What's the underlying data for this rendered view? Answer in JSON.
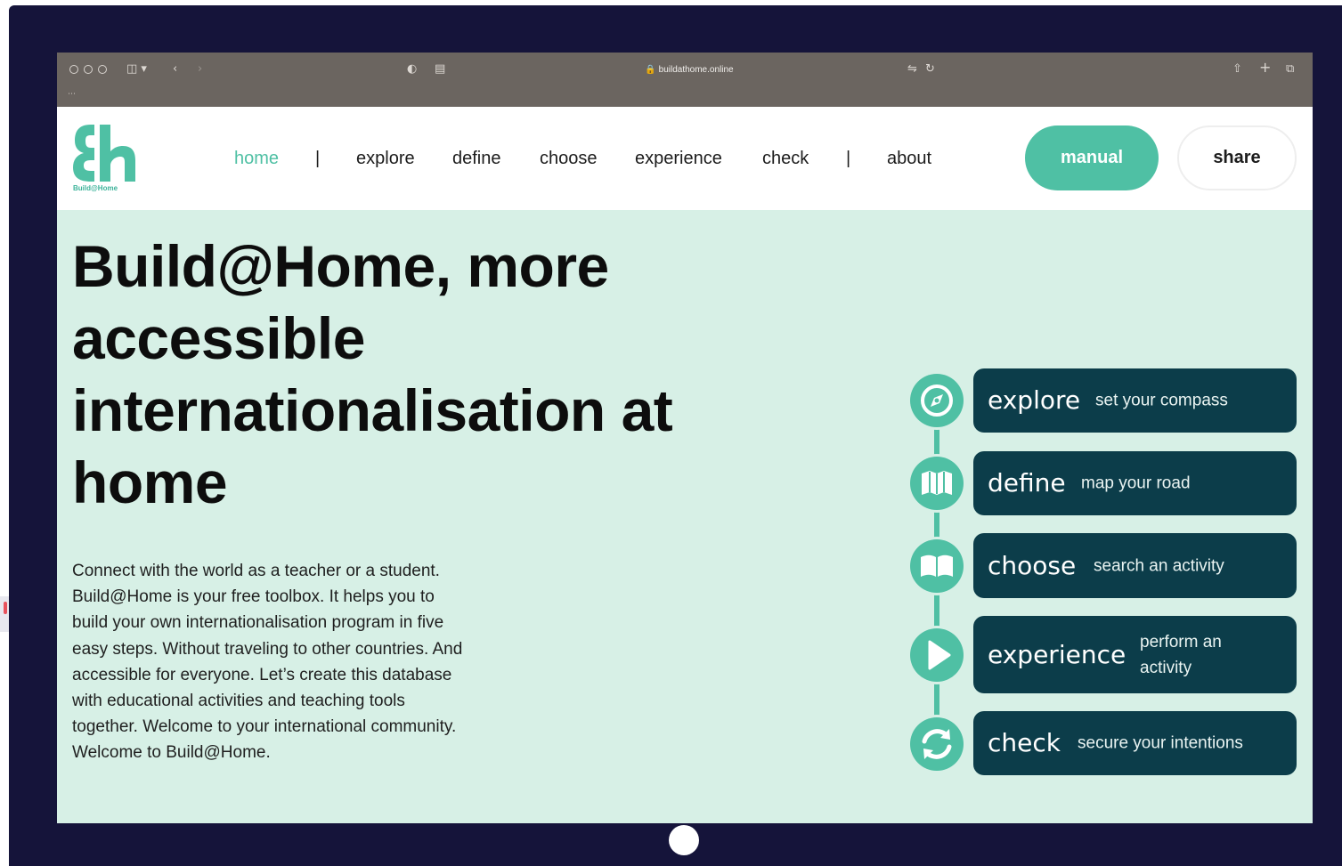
{
  "browser": {
    "url": "buildathome.online"
  },
  "logo": {
    "caption": "Build@Home"
  },
  "nav": {
    "items": [
      "home",
      "explore",
      "define",
      "choose",
      "experience",
      "check",
      "about"
    ],
    "active": "home",
    "separator": "|"
  },
  "buttons": {
    "manual": "manual",
    "share": "share"
  },
  "hero": {
    "title": "Build@Home, more accessible internationalisation at home",
    "body": "Connect with the world as a teacher or a student. Build@Home is your free toolbox. It helps you to build your own internationalisation program in five easy steps. Without traveling to other countries. And accessible for everyone. Let’s create this database with educational activities and teaching tools together. Welcome to your international community. Welcome to Build@Home."
  },
  "steps": [
    {
      "name": "explore",
      "desc": "set your compass",
      "icon": "compass-icon"
    },
    {
      "name": "define",
      "desc": "map your road",
      "icon": "map-icon"
    },
    {
      "name": "choose",
      "desc": "search an activity",
      "icon": "book-icon"
    },
    {
      "name": "experience",
      "desc": "perform an activity",
      "icon": "play-icon"
    },
    {
      "name": "check",
      "desc": "secure your intentions",
      "icon": "refresh-icon"
    }
  ],
  "colors": {
    "accent": "#4fc0a4",
    "hero_bg": "#d7f0e6",
    "step_bg": "#0c3d4a",
    "bezel": "#15143a",
    "toolbar": "#6b6560"
  }
}
